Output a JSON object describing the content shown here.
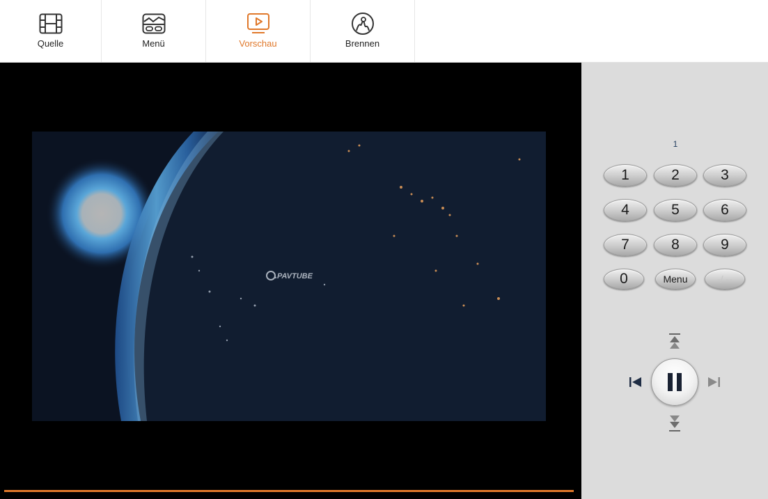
{
  "tabs": [
    {
      "label": "Quelle",
      "icon": "film-icon",
      "active": false
    },
    {
      "label": "Menü",
      "icon": "menu-layout-icon",
      "active": false
    },
    {
      "label": "Vorschau",
      "icon": "preview-play-icon",
      "active": true
    },
    {
      "label": "Brennen",
      "icon": "disc-burn-icon",
      "active": false
    }
  ],
  "preview": {
    "watermark": "PAVTUBE",
    "progress_color": "#e0782a"
  },
  "remote": {
    "display": "1",
    "keys": [
      "1",
      "2",
      "3",
      "4",
      "5",
      "6",
      "7",
      "8",
      "9",
      "0",
      "Menu",
      "-/ --"
    ],
    "disabled_keys": [
      "-/ --"
    ]
  },
  "colors": {
    "accent": "#e0782a",
    "panel_bg": "#dcdcdc",
    "video_bg": "#000000"
  }
}
